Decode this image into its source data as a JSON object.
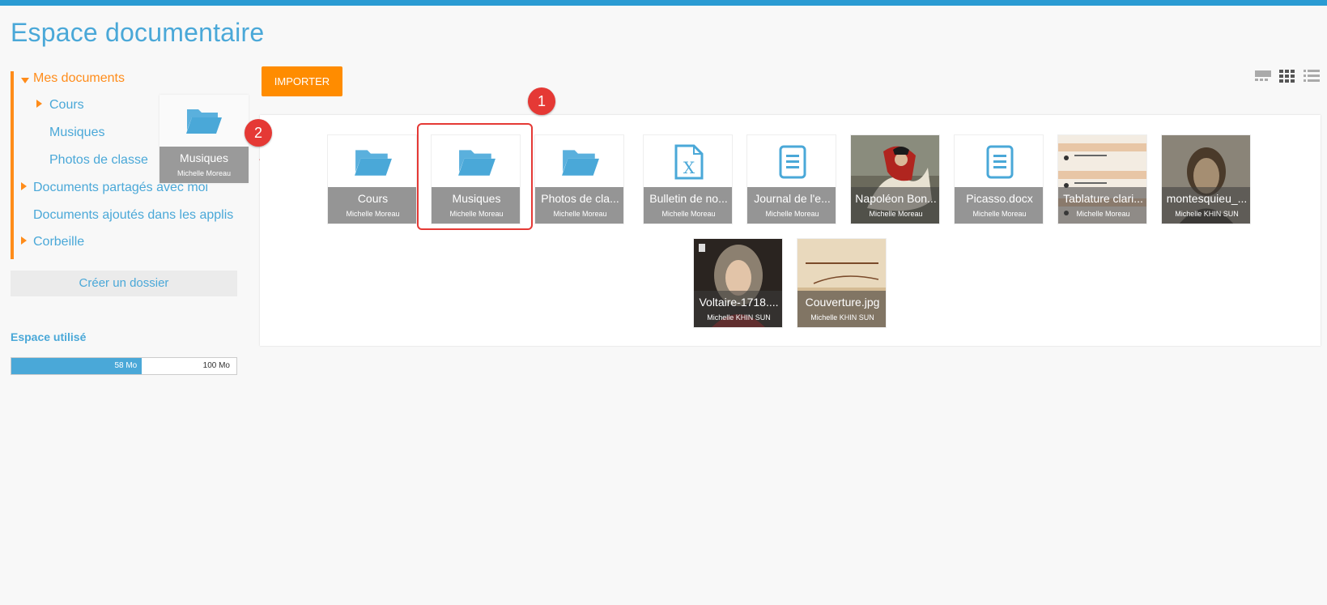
{
  "title": "Espace documentaire",
  "sidebar": {
    "tree": [
      {
        "label": "Mes documents"
      },
      {
        "label": "Cours"
      },
      {
        "label": "Musiques"
      },
      {
        "label": "Photos de classe"
      },
      {
        "label": "Documents partagés avec moi"
      },
      {
        "label": "Documents ajoutés dans les applis"
      },
      {
        "label": "Corbeille"
      }
    ],
    "create_folder_label": "Créer un dossier",
    "space_label": "Espace utilisé",
    "space_used": "58 Mo",
    "space_total": "100 Mo",
    "space_fraction": 0.58
  },
  "toolbar": {
    "import_label": "IMPORTER"
  },
  "drag_ghost": {
    "name": "Musiques",
    "owner": "Michelle Moreau"
  },
  "files": [
    {
      "name": "Cours",
      "owner": "Michelle Moreau",
      "icon": "folder-icon"
    },
    {
      "name": "Musiques",
      "owner": "Michelle Moreau",
      "icon": "folder-icon"
    },
    {
      "name": "Photos de cla...",
      "owner": "Michelle Moreau",
      "icon": "folder-icon"
    },
    {
      "name": "Bulletin de no...",
      "owner": "Michelle Moreau",
      "icon": "spreadsheet-icon"
    },
    {
      "name": "Journal de l'e...",
      "owner": "Michelle Moreau",
      "icon": "document-icon"
    },
    {
      "name": "Napoléon Bon...",
      "owner": "Michelle Moreau",
      "icon": "image-thumbnail"
    },
    {
      "name": "Picasso.docx",
      "owner": "Michelle Moreau",
      "icon": "document-icon"
    },
    {
      "name": "Tablature clari...",
      "owner": "Michelle Moreau",
      "icon": "image-thumbnail"
    },
    {
      "name": "montesquieu_...",
      "owner": "Michelle KHIN SUN",
      "icon": "image-thumbnail"
    },
    {
      "name": "Voltaire-1718....",
      "owner": "Michelle KHIN SUN",
      "icon": "image-thumbnail"
    },
    {
      "name": "Couverture.jpg",
      "owner": "Michelle KHIN SUN",
      "icon": "image-thumbnail"
    }
  ],
  "markers": [
    "1",
    "2"
  ],
  "colors": {
    "accent": "#4aa8d8",
    "orange": "#ff8c1a",
    "annotation": "#e53935"
  }
}
